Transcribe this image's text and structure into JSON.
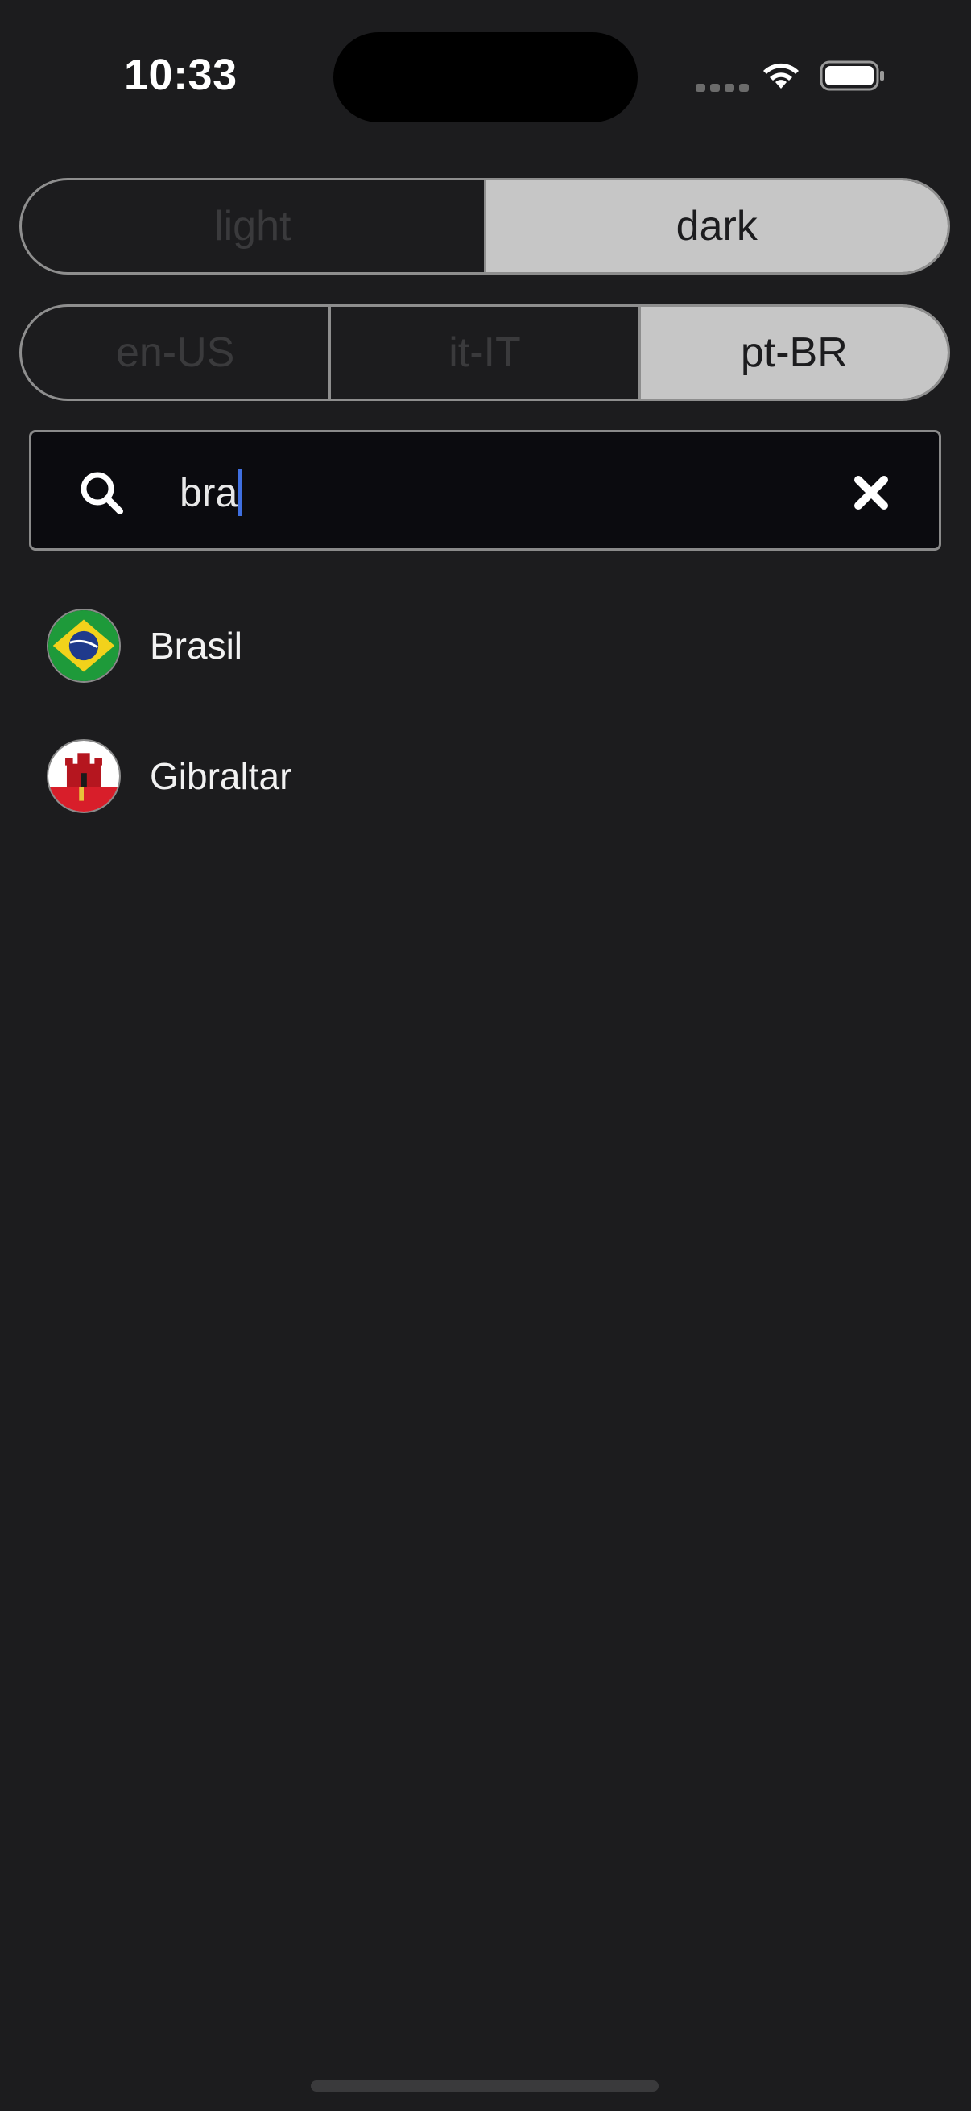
{
  "status_bar": {
    "time": "10:33"
  },
  "theme_selector": {
    "options": [
      "light",
      "dark"
    ],
    "selected": "dark"
  },
  "locale_selector": {
    "options": [
      "en-US",
      "it-IT",
      "pt-BR"
    ],
    "selected": "pt-BR"
  },
  "search": {
    "value": "bra",
    "icon": "search-icon",
    "clear_icon": "close-icon"
  },
  "results": [
    {
      "label": "Brasil",
      "flag": "flag-brazil-icon"
    },
    {
      "label": "Gibraltar",
      "flag": "flag-gibraltar-icon"
    }
  ],
  "colors": {
    "background": "#1c1c1e",
    "segment_active": "#c6c6c6",
    "segment_border": "#8e8e8e",
    "search_background": "#0b0b0f",
    "caret": "#3f6fe0"
  }
}
